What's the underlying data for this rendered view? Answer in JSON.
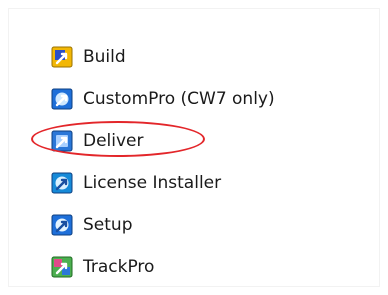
{
  "menu": {
    "items": [
      {
        "label": "Build",
        "icon": "build-app-icon",
        "color": "#f2b705"
      },
      {
        "label": "CustomPro (CW7 only)",
        "icon": "custompro-app-icon",
        "color": "#1e6fd9"
      },
      {
        "label": "Deliver",
        "icon": "deliver-app-icon",
        "color": "#2a77d8",
        "highlighted": true
      },
      {
        "label": "License Installer",
        "icon": "license-installer-app-icon",
        "color": "#168ad8"
      },
      {
        "label": "Setup",
        "icon": "setup-app-icon",
        "color": "#1e6fd9"
      },
      {
        "label": "TrackPro",
        "icon": "trackpro-app-icon",
        "color": "#4caf50"
      }
    ]
  },
  "highlight_color": "#e3262a"
}
